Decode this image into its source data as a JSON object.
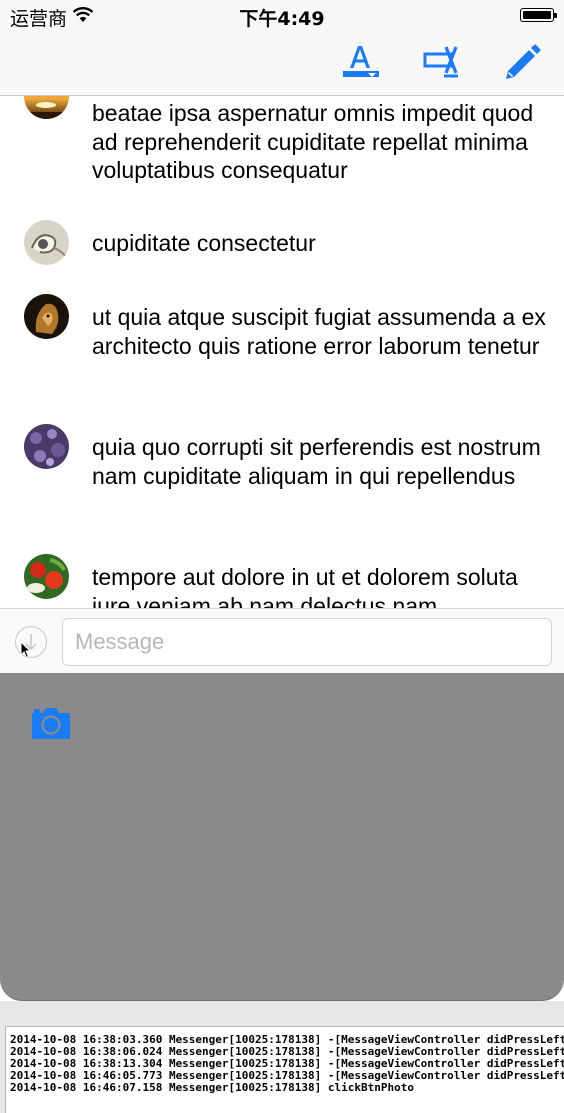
{
  "status_bar": {
    "carrier": "运营商",
    "time": "下午4:49"
  },
  "toolbar": {
    "icons": [
      "text-format-icon",
      "clear-text-icon",
      "pencil-icon"
    ],
    "accent_color": "#1a7cf5"
  },
  "messages": [
    {
      "avatar": "sunset-avatar",
      "text": "beatae ipsa aspernatur omnis impedit quod ad reprehenderit cupiditate repellat minima voluptatibus consequatur"
    },
    {
      "avatar": "earbuds-avatar",
      "text": "cupiditate consectetur"
    },
    {
      "avatar": "lion-avatar",
      "text": "ut quia atque suscipit fugiat assumenda a ex architecto quis ratione error laborum tenetur"
    },
    {
      "avatar": "purple-flowers-avatar",
      "text": "quia quo corrupti sit perferendis est nostrum nam cupiditate aliquam in qui repellendus"
    },
    {
      "avatar": "vegetables-avatar",
      "text": "tempore aut dolore in ut et dolorem soluta iure veniam ab nam delectus nam"
    }
  ],
  "input_bar": {
    "placeholder": "Message"
  },
  "extension_panel": {
    "icon": "camera-icon",
    "background_color": "#8a8a8a"
  },
  "console_log": [
    "2014-10-08 16:38:03.360 Messenger[10025:178138] -[MessageViewController didPressLeft",
    "2014-10-08 16:38:06.024 Messenger[10025:178138] -[MessageViewController didPressLeft",
    "2014-10-08 16:38:13.304 Messenger[10025:178138] -[MessageViewController didPressLeft",
    "2014-10-08 16:46:05.773 Messenger[10025:178138] -[MessageViewController didPressLeft",
    "2014-10-08 16:46:07.158 Messenger[10025:178138] clickBtnPhoto"
  ]
}
